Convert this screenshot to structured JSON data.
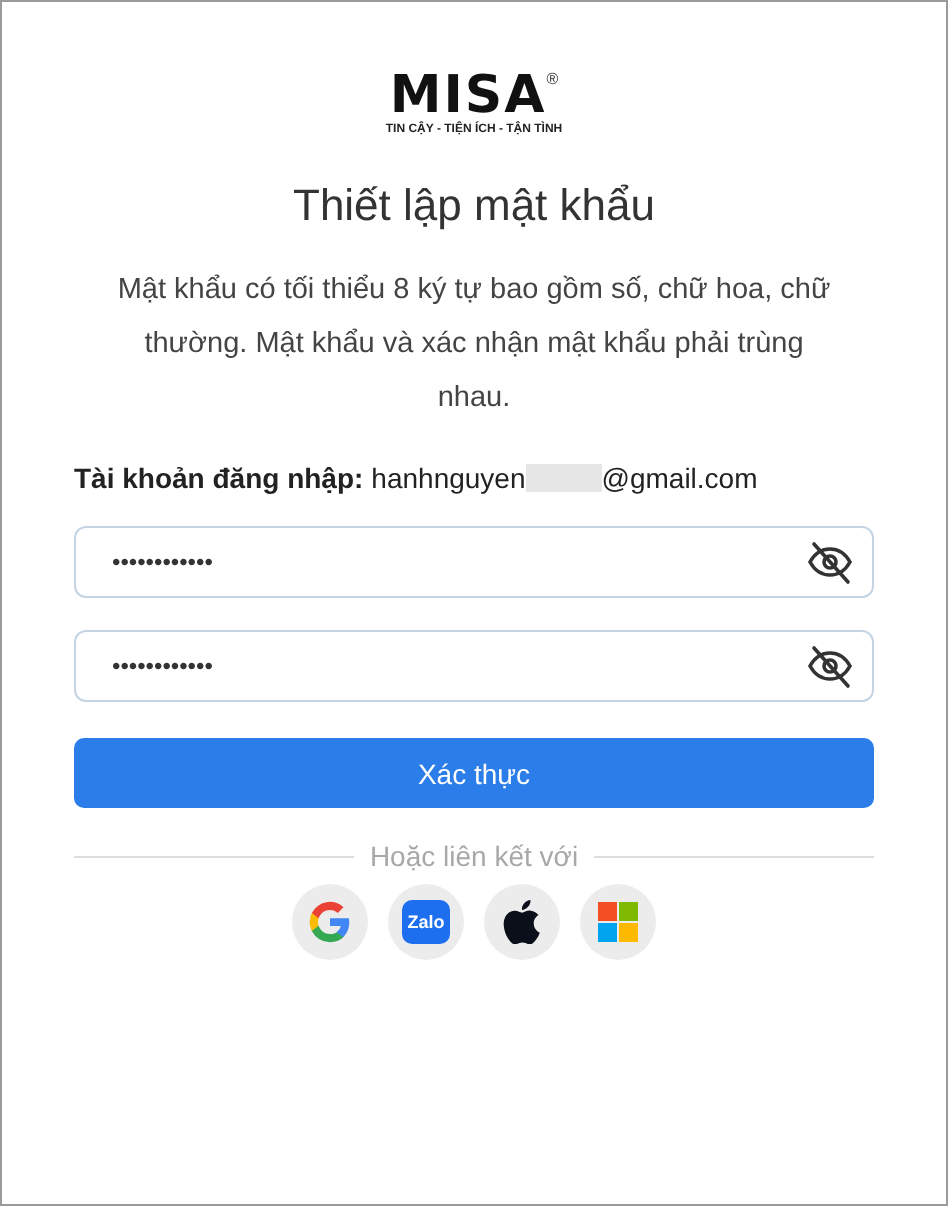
{
  "logo": {
    "name": "MISA",
    "mark": "®",
    "tagline": "TIN CẬY - TIỆN ÍCH - TẬN TÌNH"
  },
  "title": "Thiết lập mật khẩu",
  "description": "Mật khẩu có tối thiểu 8 ký tự bao gồm số, chữ hoa, chữ thường. Mật khẩu và xác nhận mật khẩu phải trùng nhau.",
  "account": {
    "label": "Tài khoản đăng nhập:",
    "value_start": "hanhnguyen",
    "value_end": "@gmail.com",
    "redacted": true
  },
  "fields": [
    {
      "value": "••••••••••••",
      "visible": false
    },
    {
      "value": "••••••••••••",
      "visible": false
    }
  ],
  "submit": "Xác thực",
  "divider": "Hoặc liên kết với",
  "providers": [
    {
      "kind": "google"
    },
    {
      "kind": "zalo",
      "label": "Zalo"
    },
    {
      "kind": "apple"
    },
    {
      "kind": "microsoft"
    }
  ]
}
